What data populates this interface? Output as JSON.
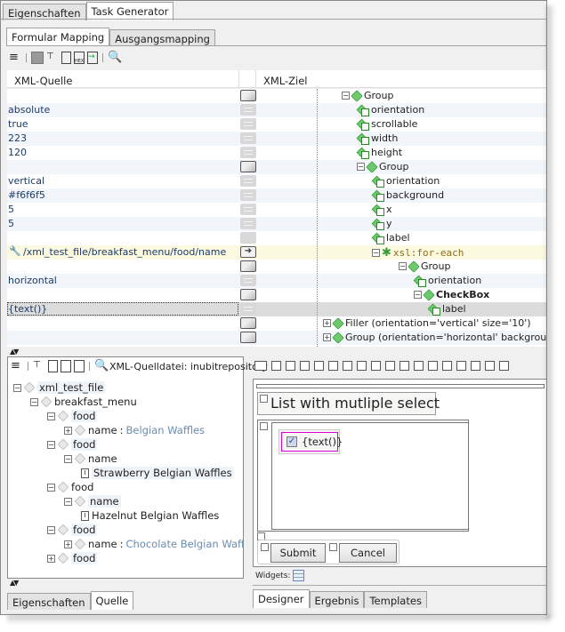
{
  "top_tabs": [
    {
      "label": "Eigenschaften",
      "active": false
    },
    {
      "label": "Task Generator",
      "active": true
    }
  ],
  "mapping_tabs": [
    {
      "label": "Formular Mapping",
      "active": true
    },
    {
      "label": "Ausgangsmapping",
      "active": false
    }
  ],
  "toolbar_icons": [
    "menu-icon",
    "grid-icon",
    "tree-icon",
    "document-icon",
    "hex-document-icon",
    "import-document-icon",
    "search-icon"
  ],
  "columns": {
    "source": "XML-Quelle",
    "target": "XML-Ziel"
  },
  "mapping_rows": [
    {
      "source": "",
      "btn": "box",
      "target": "Group",
      "kind": "group",
      "indent": 0,
      "exp": "-"
    },
    {
      "source": "absolute",
      "btn": "flat",
      "target": "orientation",
      "kind": "attr",
      "indent": 1
    },
    {
      "source": "true",
      "btn": "flat",
      "target": "scrollable",
      "kind": "attr",
      "indent": 1
    },
    {
      "source": "223",
      "btn": "flat",
      "target": "width",
      "kind": "attr",
      "indent": 1
    },
    {
      "source": "120",
      "btn": "flat",
      "target": "height",
      "kind": "attr",
      "indent": 1
    },
    {
      "source": "",
      "btn": "box",
      "target": "Group",
      "kind": "group",
      "indent": 1,
      "exp": "-"
    },
    {
      "source": "vertical",
      "btn": "flat",
      "target": "orientation",
      "kind": "attr",
      "indent": 2
    },
    {
      "source": "#f6f6f5",
      "btn": "flat",
      "target": "background",
      "kind": "attr",
      "indent": 2
    },
    {
      "source": "5",
      "btn": "flat",
      "target": "x",
      "kind": "attr",
      "indent": 2
    },
    {
      "source": "5",
      "btn": "flat",
      "target": "y",
      "kind": "attr",
      "indent": 2
    },
    {
      "source": "",
      "btn": "plain",
      "target": "label",
      "kind": "attr",
      "indent": 2
    },
    {
      "source": "/xml_test_file/breakfast_menu/food/name",
      "btn": "arrow",
      "target": "xsl:for-each",
      "kind": "xsl",
      "indent": 2,
      "exp": "-",
      "wrench": true
    },
    {
      "source": "",
      "btn": "box",
      "target": "Group",
      "kind": "group",
      "indent": 3,
      "exp": "-"
    },
    {
      "source": "horizontal",
      "btn": "flat",
      "target": "orientation",
      "kind": "attr",
      "indent": 4
    },
    {
      "source": "",
      "btn": "box",
      "target": "CheckBox",
      "kind": "group",
      "indent": 4,
      "exp": "-",
      "bold": true
    },
    {
      "source": "{text()}",
      "btn": "flat",
      "target": "label",
      "kind": "attr",
      "indent": 5,
      "selected": true
    },
    {
      "source": "",
      "btn": "box",
      "target": "Filler (orientation='vertical' size='10')",
      "kind": "group",
      "indent": -1,
      "exp": "+"
    },
    {
      "source": "",
      "btn": "box",
      "target": "Group (orientation='horizontal' background=",
      "kind": "group",
      "indent": -1,
      "exp": "+"
    }
  ],
  "source_panel": {
    "file_label": "XML-Quelldatei: inubitrepository",
    "tree": [
      {
        "label": "xml_test_file",
        "level": 0,
        "exp": "-",
        "hl": true
      },
      {
        "label": "breakfast_menu",
        "level": 1,
        "exp": "-"
      },
      {
        "label": "food",
        "level": 2,
        "exp": "-",
        "hl": true
      },
      {
        "label": "name",
        "value": "Belgian Waffles",
        "level": 3,
        "exp": "+"
      },
      {
        "label": "food",
        "level": 2,
        "exp": "-",
        "hl": true
      },
      {
        "label": "name",
        "level": 3,
        "exp": "-"
      },
      {
        "label": "Strawberry Belgian Waffles",
        "level": 4,
        "text": true,
        "hl": true
      },
      {
        "label": "food",
        "level": 2,
        "exp": "-"
      },
      {
        "label": "name",
        "level": 3,
        "exp": "-",
        "hl": true
      },
      {
        "label": "Hazelnut Belgian Waffles",
        "level": 4,
        "text": true
      },
      {
        "label": "food",
        "level": 2,
        "exp": "-",
        "hl": true
      },
      {
        "label": "name",
        "value": "Chocolate Belgian Waffles",
        "level": 3,
        "exp": "+"
      },
      {
        "label": "food",
        "level": 2,
        "exp": "+",
        "hl": true
      }
    ],
    "bottom_tabs": [
      {
        "label": "Eigenschaften",
        "active": false
      },
      {
        "label": "Quelle",
        "active": true
      }
    ]
  },
  "designer": {
    "title": "List with mutliple select",
    "checkbox_label": "{text()}",
    "checkbox_checked": true,
    "submit_label": "Submit",
    "cancel_label": "Cancel",
    "widgets_label": "Widgets:",
    "bottom_tabs": [
      {
        "label": "Designer",
        "active": true
      },
      {
        "label": "Ergebnis",
        "active": false
      },
      {
        "label": "Templates",
        "active": false
      }
    ]
  }
}
